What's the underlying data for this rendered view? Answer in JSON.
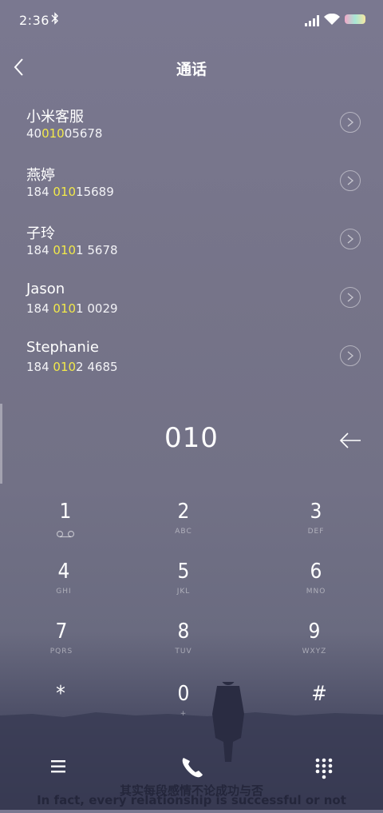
{
  "status_bar": {
    "time": "2:36",
    "bluetooth_icon": "bluetooth-icon",
    "signal_icon": "signal-icon",
    "wifi_icon": "wifi-icon",
    "battery_icon": "battery-icon"
  },
  "nav": {
    "title": "通话",
    "back_icon": "back-arrow-icon"
  },
  "contacts": [
    {
      "name": "小米客服",
      "num_pre": "40",
      "num_hl": "010",
      "num_post": "05678"
    },
    {
      "name": "燕婷",
      "num_pre": "184 ",
      "num_hl": "010",
      "num_post": "15689"
    },
    {
      "name": "子玲",
      "num_pre": "184 ",
      "num_hl": "010",
      "num_post": "1 5678"
    },
    {
      "name": "Jason",
      "num_pre": "184 ",
      "num_hl": "010",
      "num_post": "1 0029"
    },
    {
      "name": "Stephanie",
      "num_pre": "184 ",
      "num_hl": "010",
      "num_post": "2 4685"
    }
  ],
  "entry": {
    "digits": "010",
    "delete_icon": "backspace-arrow-icon"
  },
  "keypad": [
    {
      "digit": "1",
      "sub": ""
    },
    {
      "digit": "2",
      "sub": "ABC"
    },
    {
      "digit": "3",
      "sub": "DEF"
    },
    {
      "digit": "4",
      "sub": "GHI"
    },
    {
      "digit": "5",
      "sub": "JKL"
    },
    {
      "digit": "6",
      "sub": "MNO"
    },
    {
      "digit": "7",
      "sub": "PQRS"
    },
    {
      "digit": "8",
      "sub": "TUV"
    },
    {
      "digit": "9",
      "sub": "WXYZ"
    },
    {
      "digit": "*",
      "sub": ""
    },
    {
      "digit": "0",
      "sub": "+"
    },
    {
      "digit": "#",
      "sub": ""
    }
  ],
  "bottom_bar": {
    "menu_icon": "menu-icon",
    "call_icon": "phone-icon",
    "keypad_icon": "dialpad-icon"
  },
  "wallpaper": {
    "caption_cn": "其实每段感情不论成功与否",
    "caption_en": "In fact, every relationship is successful or not"
  },
  "colors": {
    "highlight": "#f2e94a",
    "background_top": "#7a7890",
    "background_bottom": "#2d2f45"
  }
}
